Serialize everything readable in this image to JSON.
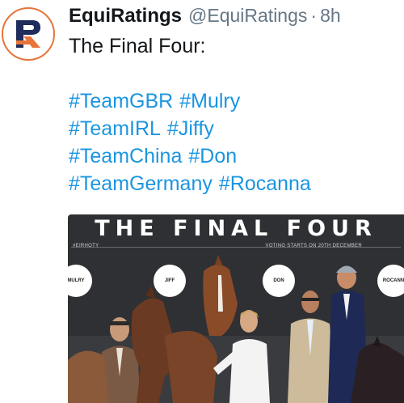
{
  "tweet": {
    "display_name": "EquiRatings",
    "handle": "@EquiRatings",
    "separator": "·",
    "time": "8h",
    "text": "The Final Four:",
    "hashtag_lines": [
      [
        "#TeamGBR",
        "#Mulry"
      ],
      [
        "#TeamIRL",
        "#Jiffy"
      ],
      [
        "#TeamChina",
        "#Don"
      ],
      [
        "#TeamGermany",
        "#Rocanna"
      ]
    ]
  },
  "media": {
    "title": "THE FINAL FOUR",
    "left_caption": "#EIRHOTY",
    "right_caption": "VOTING STARTS ON 20TH DECEMBER",
    "names": [
      "MULRY",
      "JIFF",
      "DON",
      "ROCANN"
    ]
  },
  "colors": {
    "link": "#1b95e0",
    "brand_orange": "#e8743b",
    "brand_navy": "#1f2d5c"
  }
}
